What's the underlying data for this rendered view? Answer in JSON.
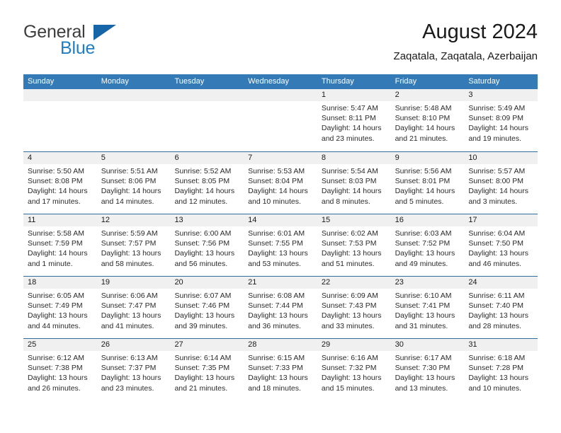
{
  "brand": {
    "word1": "General",
    "word2": "Blue",
    "triangle_color": "#1565a8",
    "blue_color": "#1f7fc4"
  },
  "header": {
    "title": "August 2024",
    "subtitle": "Zaqatala, Zaqatala, Azerbaijan"
  },
  "calendar": {
    "header_bg": "#347ab7",
    "daynum_bg": "#f0f0f0",
    "weekdays": [
      "Sunday",
      "Monday",
      "Tuesday",
      "Wednesday",
      "Thursday",
      "Friday",
      "Saturday"
    ],
    "labels": {
      "sunrise": "Sunrise:",
      "sunset": "Sunset:",
      "daylight": "Daylight:"
    },
    "weeks": [
      [
        {
          "day": "",
          "empty": true
        },
        {
          "day": "",
          "empty": true
        },
        {
          "day": "",
          "empty": true
        },
        {
          "day": "",
          "empty": true
        },
        {
          "day": "1",
          "sunrise": "Sunrise: 5:47 AM",
          "sunset": "Sunset: 8:11 PM",
          "daylight1": "Daylight: 14 hours",
          "daylight2": "and 23 minutes."
        },
        {
          "day": "2",
          "sunrise": "Sunrise: 5:48 AM",
          "sunset": "Sunset: 8:10 PM",
          "daylight1": "Daylight: 14 hours",
          "daylight2": "and 21 minutes."
        },
        {
          "day": "3",
          "sunrise": "Sunrise: 5:49 AM",
          "sunset": "Sunset: 8:09 PM",
          "daylight1": "Daylight: 14 hours",
          "daylight2": "and 19 minutes."
        }
      ],
      [
        {
          "day": "4",
          "sunrise": "Sunrise: 5:50 AM",
          "sunset": "Sunset: 8:08 PM",
          "daylight1": "Daylight: 14 hours",
          "daylight2": "and 17 minutes."
        },
        {
          "day": "5",
          "sunrise": "Sunrise: 5:51 AM",
          "sunset": "Sunset: 8:06 PM",
          "daylight1": "Daylight: 14 hours",
          "daylight2": "and 14 minutes."
        },
        {
          "day": "6",
          "sunrise": "Sunrise: 5:52 AM",
          "sunset": "Sunset: 8:05 PM",
          "daylight1": "Daylight: 14 hours",
          "daylight2": "and 12 minutes."
        },
        {
          "day": "7",
          "sunrise": "Sunrise: 5:53 AM",
          "sunset": "Sunset: 8:04 PM",
          "daylight1": "Daylight: 14 hours",
          "daylight2": "and 10 minutes."
        },
        {
          "day": "8",
          "sunrise": "Sunrise: 5:54 AM",
          "sunset": "Sunset: 8:03 PM",
          "daylight1": "Daylight: 14 hours",
          "daylight2": "and 8 minutes."
        },
        {
          "day": "9",
          "sunrise": "Sunrise: 5:56 AM",
          "sunset": "Sunset: 8:01 PM",
          "daylight1": "Daylight: 14 hours",
          "daylight2": "and 5 minutes."
        },
        {
          "day": "10",
          "sunrise": "Sunrise: 5:57 AM",
          "sunset": "Sunset: 8:00 PM",
          "daylight1": "Daylight: 14 hours",
          "daylight2": "and 3 minutes."
        }
      ],
      [
        {
          "day": "11",
          "sunrise": "Sunrise: 5:58 AM",
          "sunset": "Sunset: 7:59 PM",
          "daylight1": "Daylight: 14 hours",
          "daylight2": "and 1 minute."
        },
        {
          "day": "12",
          "sunrise": "Sunrise: 5:59 AM",
          "sunset": "Sunset: 7:57 PM",
          "daylight1": "Daylight: 13 hours",
          "daylight2": "and 58 minutes."
        },
        {
          "day": "13",
          "sunrise": "Sunrise: 6:00 AM",
          "sunset": "Sunset: 7:56 PM",
          "daylight1": "Daylight: 13 hours",
          "daylight2": "and 56 minutes."
        },
        {
          "day": "14",
          "sunrise": "Sunrise: 6:01 AM",
          "sunset": "Sunset: 7:55 PM",
          "daylight1": "Daylight: 13 hours",
          "daylight2": "and 53 minutes."
        },
        {
          "day": "15",
          "sunrise": "Sunrise: 6:02 AM",
          "sunset": "Sunset: 7:53 PM",
          "daylight1": "Daylight: 13 hours",
          "daylight2": "and 51 minutes."
        },
        {
          "day": "16",
          "sunrise": "Sunrise: 6:03 AM",
          "sunset": "Sunset: 7:52 PM",
          "daylight1": "Daylight: 13 hours",
          "daylight2": "and 49 minutes."
        },
        {
          "day": "17",
          "sunrise": "Sunrise: 6:04 AM",
          "sunset": "Sunset: 7:50 PM",
          "daylight1": "Daylight: 13 hours",
          "daylight2": "and 46 minutes."
        }
      ],
      [
        {
          "day": "18",
          "sunrise": "Sunrise: 6:05 AM",
          "sunset": "Sunset: 7:49 PM",
          "daylight1": "Daylight: 13 hours",
          "daylight2": "and 44 minutes."
        },
        {
          "day": "19",
          "sunrise": "Sunrise: 6:06 AM",
          "sunset": "Sunset: 7:47 PM",
          "daylight1": "Daylight: 13 hours",
          "daylight2": "and 41 minutes."
        },
        {
          "day": "20",
          "sunrise": "Sunrise: 6:07 AM",
          "sunset": "Sunset: 7:46 PM",
          "daylight1": "Daylight: 13 hours",
          "daylight2": "and 39 minutes."
        },
        {
          "day": "21",
          "sunrise": "Sunrise: 6:08 AM",
          "sunset": "Sunset: 7:44 PM",
          "daylight1": "Daylight: 13 hours",
          "daylight2": "and 36 minutes."
        },
        {
          "day": "22",
          "sunrise": "Sunrise: 6:09 AM",
          "sunset": "Sunset: 7:43 PM",
          "daylight1": "Daylight: 13 hours",
          "daylight2": "and 33 minutes."
        },
        {
          "day": "23",
          "sunrise": "Sunrise: 6:10 AM",
          "sunset": "Sunset: 7:41 PM",
          "daylight1": "Daylight: 13 hours",
          "daylight2": "and 31 minutes."
        },
        {
          "day": "24",
          "sunrise": "Sunrise: 6:11 AM",
          "sunset": "Sunset: 7:40 PM",
          "daylight1": "Daylight: 13 hours",
          "daylight2": "and 28 minutes."
        }
      ],
      [
        {
          "day": "25",
          "sunrise": "Sunrise: 6:12 AM",
          "sunset": "Sunset: 7:38 PM",
          "daylight1": "Daylight: 13 hours",
          "daylight2": "and 26 minutes."
        },
        {
          "day": "26",
          "sunrise": "Sunrise: 6:13 AM",
          "sunset": "Sunset: 7:37 PM",
          "daylight1": "Daylight: 13 hours",
          "daylight2": "and 23 minutes."
        },
        {
          "day": "27",
          "sunrise": "Sunrise: 6:14 AM",
          "sunset": "Sunset: 7:35 PM",
          "daylight1": "Daylight: 13 hours",
          "daylight2": "and 21 minutes."
        },
        {
          "day": "28",
          "sunrise": "Sunrise: 6:15 AM",
          "sunset": "Sunset: 7:33 PM",
          "daylight1": "Daylight: 13 hours",
          "daylight2": "and 18 minutes."
        },
        {
          "day": "29",
          "sunrise": "Sunrise: 6:16 AM",
          "sunset": "Sunset: 7:32 PM",
          "daylight1": "Daylight: 13 hours",
          "daylight2": "and 15 minutes."
        },
        {
          "day": "30",
          "sunrise": "Sunrise: 6:17 AM",
          "sunset": "Sunset: 7:30 PM",
          "daylight1": "Daylight: 13 hours",
          "daylight2": "and 13 minutes."
        },
        {
          "day": "31",
          "sunrise": "Sunrise: 6:18 AM",
          "sunset": "Sunset: 7:28 PM",
          "daylight1": "Daylight: 13 hours",
          "daylight2": "and 10 minutes."
        }
      ]
    ]
  }
}
